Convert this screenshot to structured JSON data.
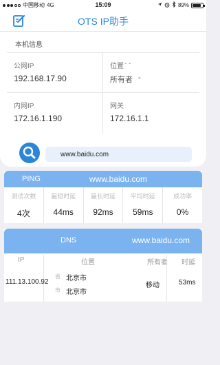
{
  "status": {
    "carrier": "中国移动",
    "network": "4G",
    "time": "15:09",
    "battery": "89%",
    "battery_level": 0.89
  },
  "nav": {
    "title": "OTS IP助手",
    "edit_icon": "edit-icon"
  },
  "info": {
    "section": "本机信息",
    "public_ip_label": "公网IP",
    "public_ip_value": "192.168.17.90",
    "location_label": "位置",
    "location_value": "- -",
    "owner_label": "所有者",
    "owner_value": "-",
    "private_ip_label": "内网IP",
    "private_ip_value": "172.16.1.190",
    "gateway_label": "网关",
    "gateway_value": "172.16.1.1"
  },
  "search": {
    "value": "www.baidu.com",
    "icon": "search-icon",
    "accent": "#2a86d9"
  },
  "ping": {
    "title": "PING",
    "host": "www.baidu.com",
    "headers": [
      "测试次数",
      "最短时延",
      "最长时延",
      "平均时延",
      "成功率"
    ],
    "values": [
      "4次",
      "44ms",
      "92ms",
      "59ms",
      "0%"
    ]
  },
  "dns": {
    "title": "DNS",
    "host": "www.baidu.com",
    "headers": {
      "ip": "IP",
      "location": "位置",
      "owner": "所有者",
      "latency": "时延"
    },
    "row": {
      "ip": "111.13.100.92",
      "province_label": "省",
      "province": "北京市",
      "city_label": "市",
      "city": "北京市",
      "owner": "移动",
      "latency": "53ms"
    }
  }
}
